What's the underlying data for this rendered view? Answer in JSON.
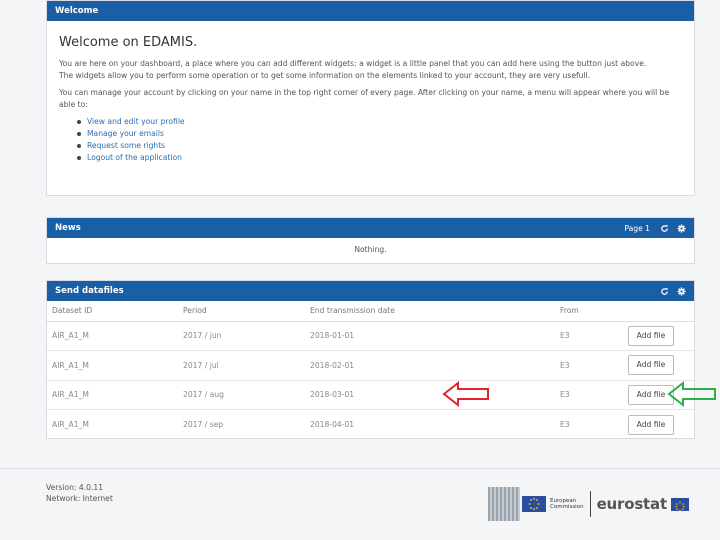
{
  "welcome": {
    "header": "Welcome",
    "title": "Welcome on EDAMIS.",
    "para1": "You are here on your dashboard, a place where you can add different widgets: a widget is a little panel that you can add here using the button just above.",
    "para2": "The widgets allow you to perform some operation or to get some information on the elements linked to your account, they are very usefull.",
    "para3": "You can manage your account by clicking on your name in the top right corner of every page. After clicking on your name, a menu will appear where you will be able to:",
    "links": [
      "View and edit your profile",
      "Manage your emails",
      "Request some rights",
      "Logout of the application"
    ]
  },
  "news": {
    "header": "News",
    "page_label": "Page 1",
    "empty": "Nothing."
  },
  "files": {
    "header": "Send datafiles",
    "columns": [
      "Dataset ID",
      "Period",
      "End transmission date",
      "From",
      ""
    ],
    "rows": [
      {
        "dataset": "AIR_A1_M",
        "period": "2017 / jun",
        "end": "2018-01-01",
        "from": "E3",
        "action": "Add file"
      },
      {
        "dataset": "AIR_A1_M",
        "period": "2017 / jul",
        "end": "2018-02-01",
        "from": "E3",
        "action": "Add file"
      },
      {
        "dataset": "AIR_A1_M",
        "period": "2017 / aug",
        "end": "2018-03-01",
        "from": "E3",
        "action": "Add file"
      },
      {
        "dataset": "AIR_A1_M",
        "period": "2017 / sep",
        "end": "2018-04-01",
        "from": "E3",
        "action": "Add file"
      }
    ]
  },
  "footer": {
    "version": "Version: 4.0.11",
    "network": "Network: Internet"
  },
  "logo": {
    "ec_line1": "European",
    "ec_line2": "Commission",
    "eurostat": "eurostat"
  },
  "colors": {
    "header_blue": "#1a5fa6",
    "link_blue": "#2e6db4",
    "arrow_red": "#e0262b",
    "arrow_green": "#2eae4a"
  },
  "icons": [
    "refresh-icon",
    "gear-icon"
  ]
}
